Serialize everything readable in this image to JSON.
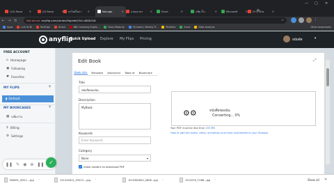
{
  "browser": {
    "tabs": [
      {
        "title": "(10) Recor",
        "color": "#ea4335"
      },
      {
        "title": "(9) Recor",
        "color": "#ea4335"
      },
      {
        "title": "หาไฟล์ในกา",
        "color": "#ea4335"
      },
      {
        "title": "Manage",
        "color": "#ffffff",
        "active": true
      },
      {
        "title": "แปลงภาษา",
        "color": "#ea4335"
      },
      {
        "title": "Excel",
        "color": "#34a853"
      },
      {
        "title": "แฟ้ม ถ้ำเ",
        "color": "#34a853"
      },
      {
        "title": "Microsoft",
        "color": "#34a853"
      },
      {
        "title": "(9+) ปักษ",
        "color": "#ea4335"
      }
    ],
    "address": {
      "security": "Not secure",
      "url": "anyflip.com/center/flip/edit/?id=4800018"
    },
    "bookmarks": [
      {
        "label": "Apps",
        "color": "#4285f4"
      },
      {
        "label": "แปล Yo Bi",
        "color": "#ea4335"
      },
      {
        "label": "YouTube",
        "color": "#ea4335"
      },
      {
        "label": "Gmail",
        "color": "#ea4335"
      },
      {
        "label": "BBC Learning Englis...",
        "color": "#b80000"
      },
      {
        "label": "Class Material",
        "color": "#34a853"
      },
      {
        "label": "PyCodes | Weekly P...",
        "color": "#4285f4"
      },
      {
        "label": "Portfolio",
        "color": "#fbbc05"
      },
      {
        "label": "Excel",
        "color": "#34a853"
      },
      {
        "label": "Data Analysis",
        "color": "#fbbc05"
      }
    ],
    "bookmarks_other": "Other bookmarks"
  },
  "app": {
    "brand": "anyflip",
    "nav": [
      "Quick Upload",
      "Explore",
      "My Flips",
      "Pricing"
    ],
    "user": "อนันต์ส"
  },
  "sidebar": {
    "account_heading": "FREE ACCOUNT",
    "account_items": [
      {
        "label": "Homepage",
        "icon": "home-icon"
      },
      {
        "label": "Following",
        "icon": "following-icon"
      },
      {
        "label": "Favorites",
        "icon": "heart-icon"
      }
    ],
    "flips_heading": "MY FLIPS",
    "flips_default": "Default",
    "bookcases_heading": "MY BOOKCASES",
    "bookcase_item": "แฟ้มงาน",
    "billing": "Billing",
    "settings": "Settings"
  },
  "editor": {
    "title": "Edit Book",
    "tabs": [
      "Book Info",
      "Template",
      "Advanced",
      "Table of",
      "Bookmark"
    ],
    "title_label": "Title",
    "title_value": "หนังสือของฉัน",
    "description_label": "Description",
    "description_value": "MyBook",
    "keywords_label": "Keywords",
    "keywords_placeholder": "Enter Keywords",
    "category_label": "Category",
    "category_value": "None",
    "allow_download_label": "Allow readers to download PDF",
    "preview_title": "หนังสือของฉัน",
    "preview_status": "Converting... 0%",
    "pdf_note": "Your PDF must be less than",
    "pdf_limit": "150 MB",
    "pdf_link": "How to add the audio, video, animation and more multimedia to your flipbook"
  },
  "downloads": [
    {
      "name": "NSWS1_SDV1....jpg"
    },
    {
      "name": "151224812_29513....jpg"
    },
    {
      "name": "1510382642_0806...jpg"
    },
    {
      "name": "1510259_TU68...jpg"
    }
  ],
  "downloads_show_all": "Show all"
}
